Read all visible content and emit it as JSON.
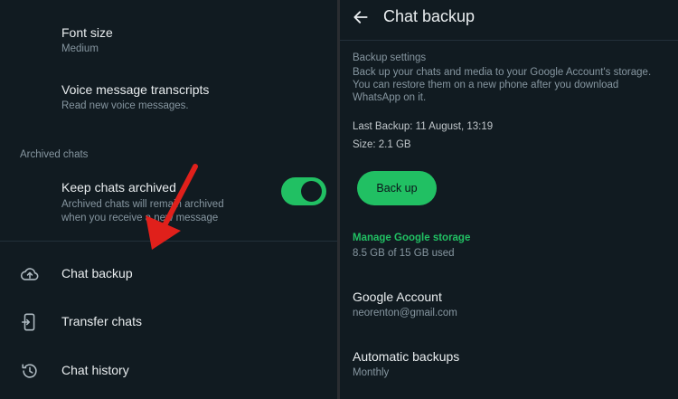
{
  "colors": {
    "accent": "#21c063",
    "background": "#111b21",
    "arrow": "#e0201b"
  },
  "left": {
    "font_size": {
      "title": "Font size",
      "value": "Medium"
    },
    "voice_transcripts": {
      "title": "Voice message transcripts",
      "subtitle": "Read new voice messages."
    },
    "archived_section": "Archived chats",
    "keep_archived": {
      "title": "Keep chats archived",
      "subtitle_line1": "Archived chats will remain archived",
      "subtitle_line2": "when you receive a new message",
      "toggle_on": true
    },
    "menu": [
      {
        "label": "Chat backup",
        "icon": "cloud-upload-icon"
      },
      {
        "label": "Transfer chats",
        "icon": "phone-transfer-icon"
      },
      {
        "label": "Chat history",
        "icon": "history-icon"
      }
    ]
  },
  "right": {
    "header": "Chat backup",
    "backup_settings": {
      "heading": "Backup settings",
      "line1": "Back up your chats and media to your Google Account's storage.",
      "line2": "You can restore them on a new phone after you download",
      "line3": "WhatsApp on it."
    },
    "last_backup": "Last Backup: 11 August, 13:19",
    "size": "Size: 2.1 GB",
    "backup_button": "Back up",
    "manage_storage": "Manage Google storage",
    "storage_used": "8.5 GB of 15 GB used",
    "google_account": {
      "title": "Google Account",
      "value": "neorenton@gmail.com"
    },
    "automatic_backups": {
      "title": "Automatic backups",
      "value": "Monthly"
    }
  }
}
